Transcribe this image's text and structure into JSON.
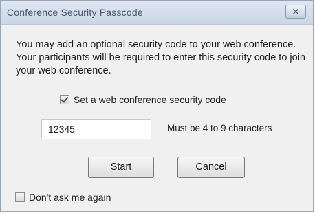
{
  "window": {
    "title": "Conference Security Passcode",
    "close_glyph": "✕"
  },
  "message": "You may add an optional security code to your web conference.  Your participants will be required to enter this security code to join your web conference.",
  "security_checkbox": {
    "label": "Set a web conference security code",
    "checked": true
  },
  "code_field": {
    "value": "12345",
    "hint": "Must be 4 to 9 characters"
  },
  "buttons": {
    "start": "Start",
    "cancel": "Cancel"
  },
  "dont_ask_checkbox": {
    "label": "Don't ask me again",
    "checked": false
  },
  "colors": {
    "titlebar": "#c9d6e7",
    "dialog_bg": "#f0f0f0",
    "text": "#1e1e1e"
  }
}
